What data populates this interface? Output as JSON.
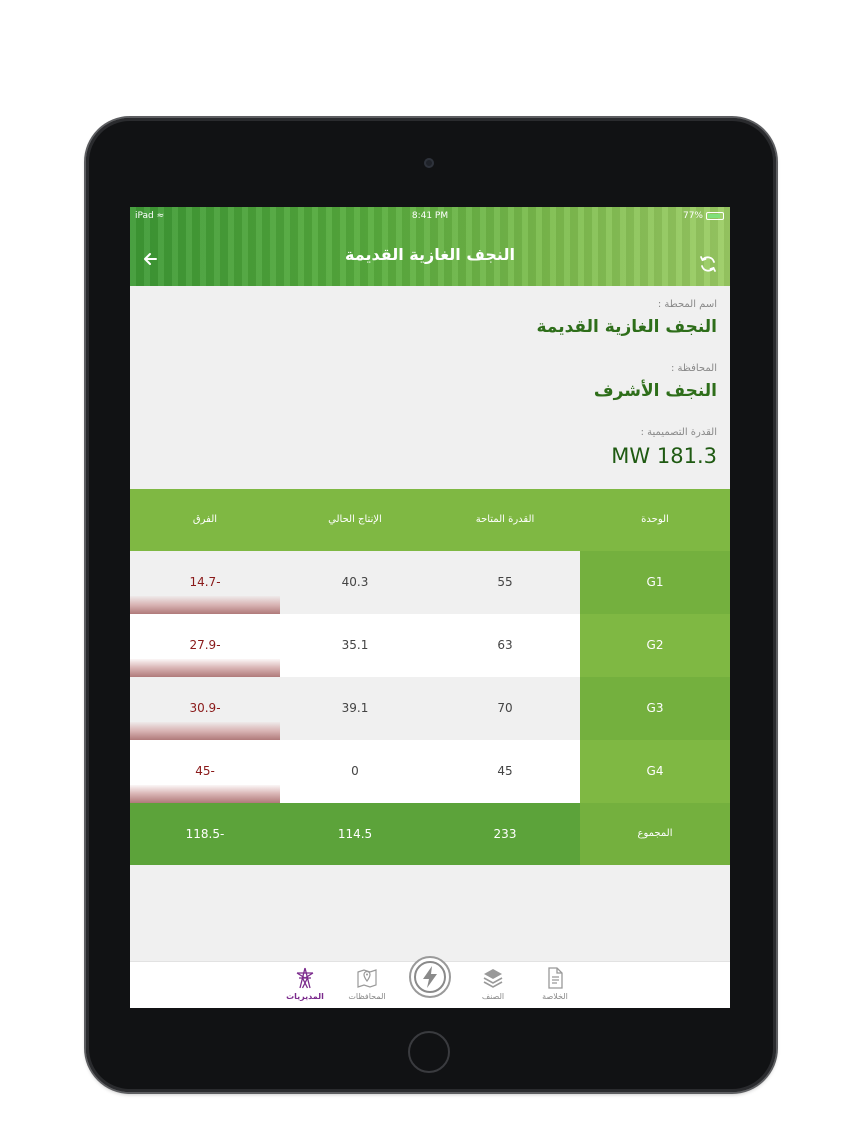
{
  "status_bar": {
    "device": "iPad",
    "time": "8:41 PM",
    "battery": "77%"
  },
  "header": {
    "title": "النجف الغازية القديمة"
  },
  "station": {
    "name_label": "اسم المحطة :",
    "name": "النجف الغازية القديمة",
    "province_label": "المحافظة :",
    "province": "النجف الأشرف",
    "capacity_label": "القدرة التصميمية :",
    "capacity": "181.3 MW"
  },
  "table": {
    "headers": [
      "الوحدة",
      "القدرة المتاحة",
      "الإنتاج الحالي",
      "الفرق"
    ],
    "rows": [
      {
        "unit": "G1",
        "available": "55",
        "production": "40.3",
        "diff": "-14.7"
      },
      {
        "unit": "G2",
        "available": "63",
        "production": "35.1",
        "diff": "-27.9"
      },
      {
        "unit": "G3",
        "available": "70",
        "production": "39.1",
        "diff": "-30.9"
      },
      {
        "unit": "G4",
        "available": "45",
        "production": "0",
        "diff": "-45"
      }
    ],
    "total": {
      "label": "المجموع",
      "available": "233",
      "production": "114.5",
      "diff": "-118.5"
    }
  },
  "tabbar": {
    "items": [
      {
        "label": "المديريات",
        "icon": "tower-icon",
        "active": true
      },
      {
        "label": "المحافظات",
        "icon": "map-pin-icon",
        "active": false
      },
      {
        "label": "",
        "icon": "lightning-icon",
        "active": false
      },
      {
        "label": "الصنف",
        "icon": "layers-icon",
        "active": false
      },
      {
        "label": "الخلاصة",
        "icon": "document-icon",
        "active": false
      }
    ]
  },
  "colors": {
    "accent_green": "#7fb843",
    "total_green": "#5ca33a",
    "negative": "#8a1a1a",
    "active_tab": "#7b2a8c"
  }
}
